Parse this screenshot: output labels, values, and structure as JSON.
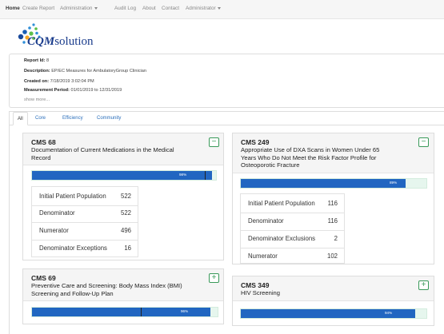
{
  "nav": {
    "home": "Home",
    "create_report": "Create Report",
    "administration": "Administration",
    "audit_log": "Audit Log",
    "about": "About",
    "contact": "Contact",
    "user": "Administrator"
  },
  "logo": {
    "strong": "CQM",
    "rest": "solution"
  },
  "report": {
    "id_label": "Report Id:",
    "id_value": "8",
    "desc_label": "Description:",
    "desc_value": "EP/EC Measures for AmbulatoryGroup Clinician",
    "created_label": "Created on:",
    "created_value": "7/18/2019 3:02:04 PM",
    "period_label": "Measurement Period:",
    "period_value": "01/01/2019 to 12/31/2019",
    "show_more": "show more..."
  },
  "tabs": [
    "All",
    "Core",
    "Efficiency",
    "Community"
  ],
  "colors": {
    "bar": "#2166c1",
    "track": "#e6f6ee",
    "toggle": "#3a9a5a"
  },
  "measures": [
    {
      "id": "CMS 68",
      "title_lines": [
        "Documentation of Current Medications in the Medical",
        "Record"
      ],
      "toggle": "−",
      "progress": 98,
      "progress_label": "98%",
      "stats": [
        {
          "label": "Initial Patient Population",
          "value": "522"
        },
        {
          "label": "Denominator",
          "value": "522"
        },
        {
          "label": "Numerator",
          "value": "496"
        },
        {
          "label": "Denominator Exceptions",
          "value": "16"
        }
      ]
    },
    {
      "id": "CMS 249",
      "title_lines": [
        "Appropriate Use of DXA Scans in Women Under 65",
        "Years Who Do Not Meet the Risk Factor Profile for",
        "Osteoporotic Fracture"
      ],
      "toggle": "−",
      "progress": 89,
      "progress_label": "89%",
      "stats": [
        {
          "label": "Initial Patient Population",
          "value": "116"
        },
        {
          "label": "Denominator",
          "value": "116"
        },
        {
          "label": "Denominator Exclusions",
          "value": "2"
        },
        {
          "label": "Numerator",
          "value": "102"
        }
      ]
    },
    {
      "id": "CMS 69",
      "title_lines": [
        "Preventive Care and Screening: Body Mass Index (BMI)",
        "Screening and Follow-Up Plan"
      ],
      "toggle": "+",
      "progress": 96,
      "progress_label": "96%"
    },
    {
      "id": "CMS 349",
      "title_lines": [
        "HIV Screening"
      ],
      "toggle": "+",
      "progress": 94,
      "progress_label": "94%"
    }
  ]
}
